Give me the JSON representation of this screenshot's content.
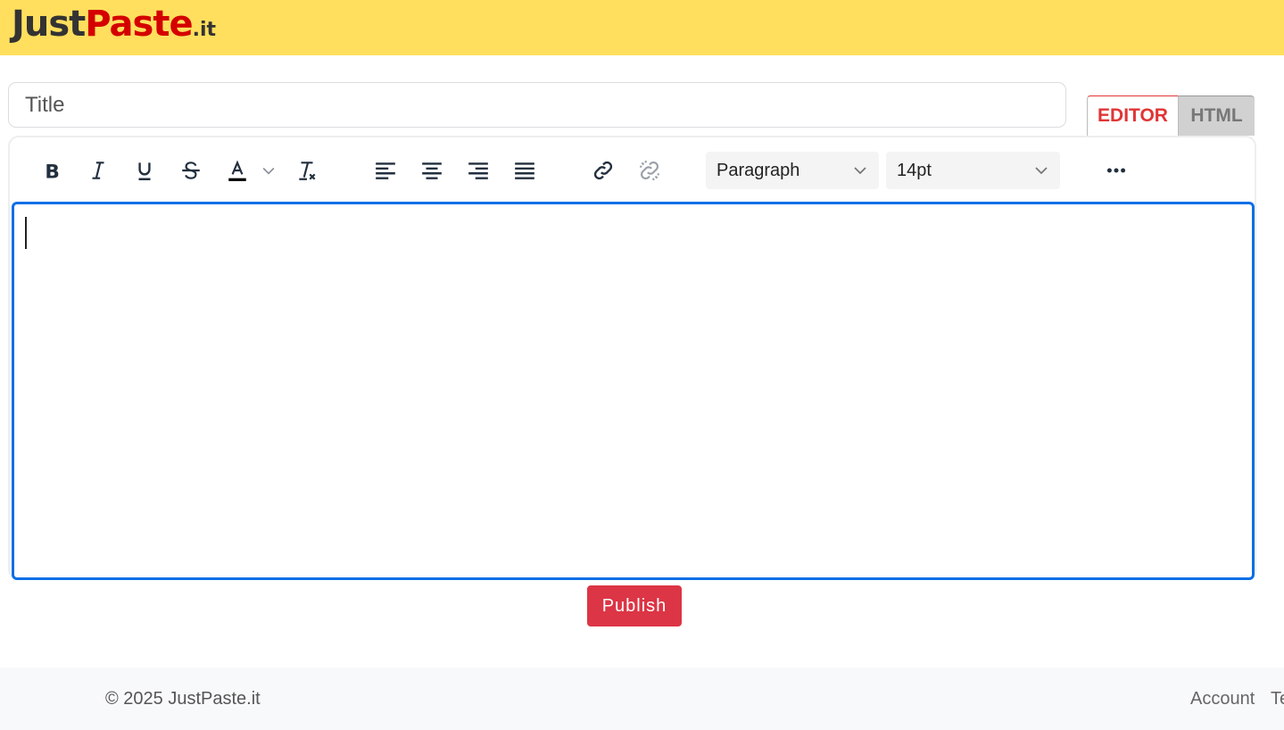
{
  "header": {
    "logo": {
      "just": "Just",
      "paste": "Paste",
      "tld": ".it"
    }
  },
  "title_input": {
    "placeholder": "Title"
  },
  "tabs": [
    {
      "label": "EDITOR"
    },
    {
      "label": "HTML"
    }
  ],
  "toolbar": {
    "icons": [
      "bold-icon",
      "italic-icon",
      "underline-icon",
      "strikethrough-icon",
      "text-color-icon",
      "clear-formatting-icon",
      "align-left-icon",
      "align-center-icon",
      "align-right-icon",
      "align-justify-icon",
      "link-icon",
      "unlink-icon",
      "more-icon"
    ],
    "block_format": "Paragraph",
    "font_size": "14pt",
    "text_color": "#000000"
  },
  "publish_label": "Publish",
  "footer": {
    "copyright": "© 2025 JustPaste.it",
    "links": [
      "Account",
      "Te"
    ]
  },
  "colors": {
    "header": "#ffdf5d",
    "accent": "#dc3545",
    "focus": "#0a6fe6"
  }
}
